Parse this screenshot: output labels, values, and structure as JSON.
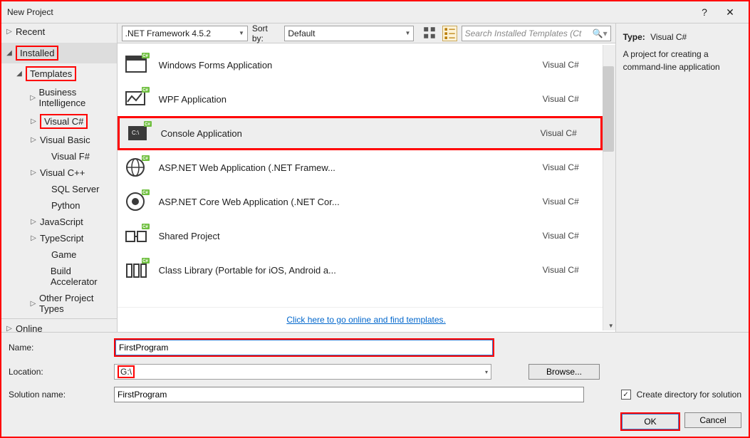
{
  "title": "New Project",
  "tree": {
    "recent": "Recent",
    "installed": "Installed",
    "templates": "Templates",
    "items": [
      "Business Intelligence",
      "Visual C#",
      "Visual Basic",
      "Visual F#",
      "Visual C++",
      "SQL Server",
      "Python",
      "JavaScript",
      "TypeScript",
      "Game",
      "Build Accelerator",
      "Other Project Types"
    ],
    "online": "Online"
  },
  "topbar": {
    "framework": ".NET Framework 4.5.2",
    "sortby_label": "Sort by:",
    "sortby": "Default",
    "search_placeholder": "Search Installed Templates (Ct"
  },
  "templates": [
    {
      "name": "Windows Forms Application",
      "lang": "Visual C#"
    },
    {
      "name": "WPF Application",
      "lang": "Visual C#"
    },
    {
      "name": "Console Application",
      "lang": "Visual C#",
      "selected": true
    },
    {
      "name": "ASP.NET Web Application (.NET Framew...",
      "lang": "Visual C#"
    },
    {
      "name": "ASP.NET Core Web Application (.NET Cor...",
      "lang": "Visual C#"
    },
    {
      "name": "Shared Project",
      "lang": "Visual C#"
    },
    {
      "name": "Class Library (Portable for iOS, Android a...",
      "lang": "Visual C#"
    }
  ],
  "online_link": "Click here to go online and find templates.",
  "details": {
    "type_label": "Type:",
    "type_value": "Visual C#",
    "description": "A project for creating a command-line application"
  },
  "form": {
    "name_label": "Name:",
    "name_value": "FirstProgram",
    "location_label": "Location:",
    "location_value": "G:\\",
    "solution_label": "Solution name:",
    "solution_value": "FirstProgram",
    "browse": "Browse...",
    "create_dir": "Create directory for solution",
    "ok": "OK",
    "cancel": "Cancel"
  }
}
